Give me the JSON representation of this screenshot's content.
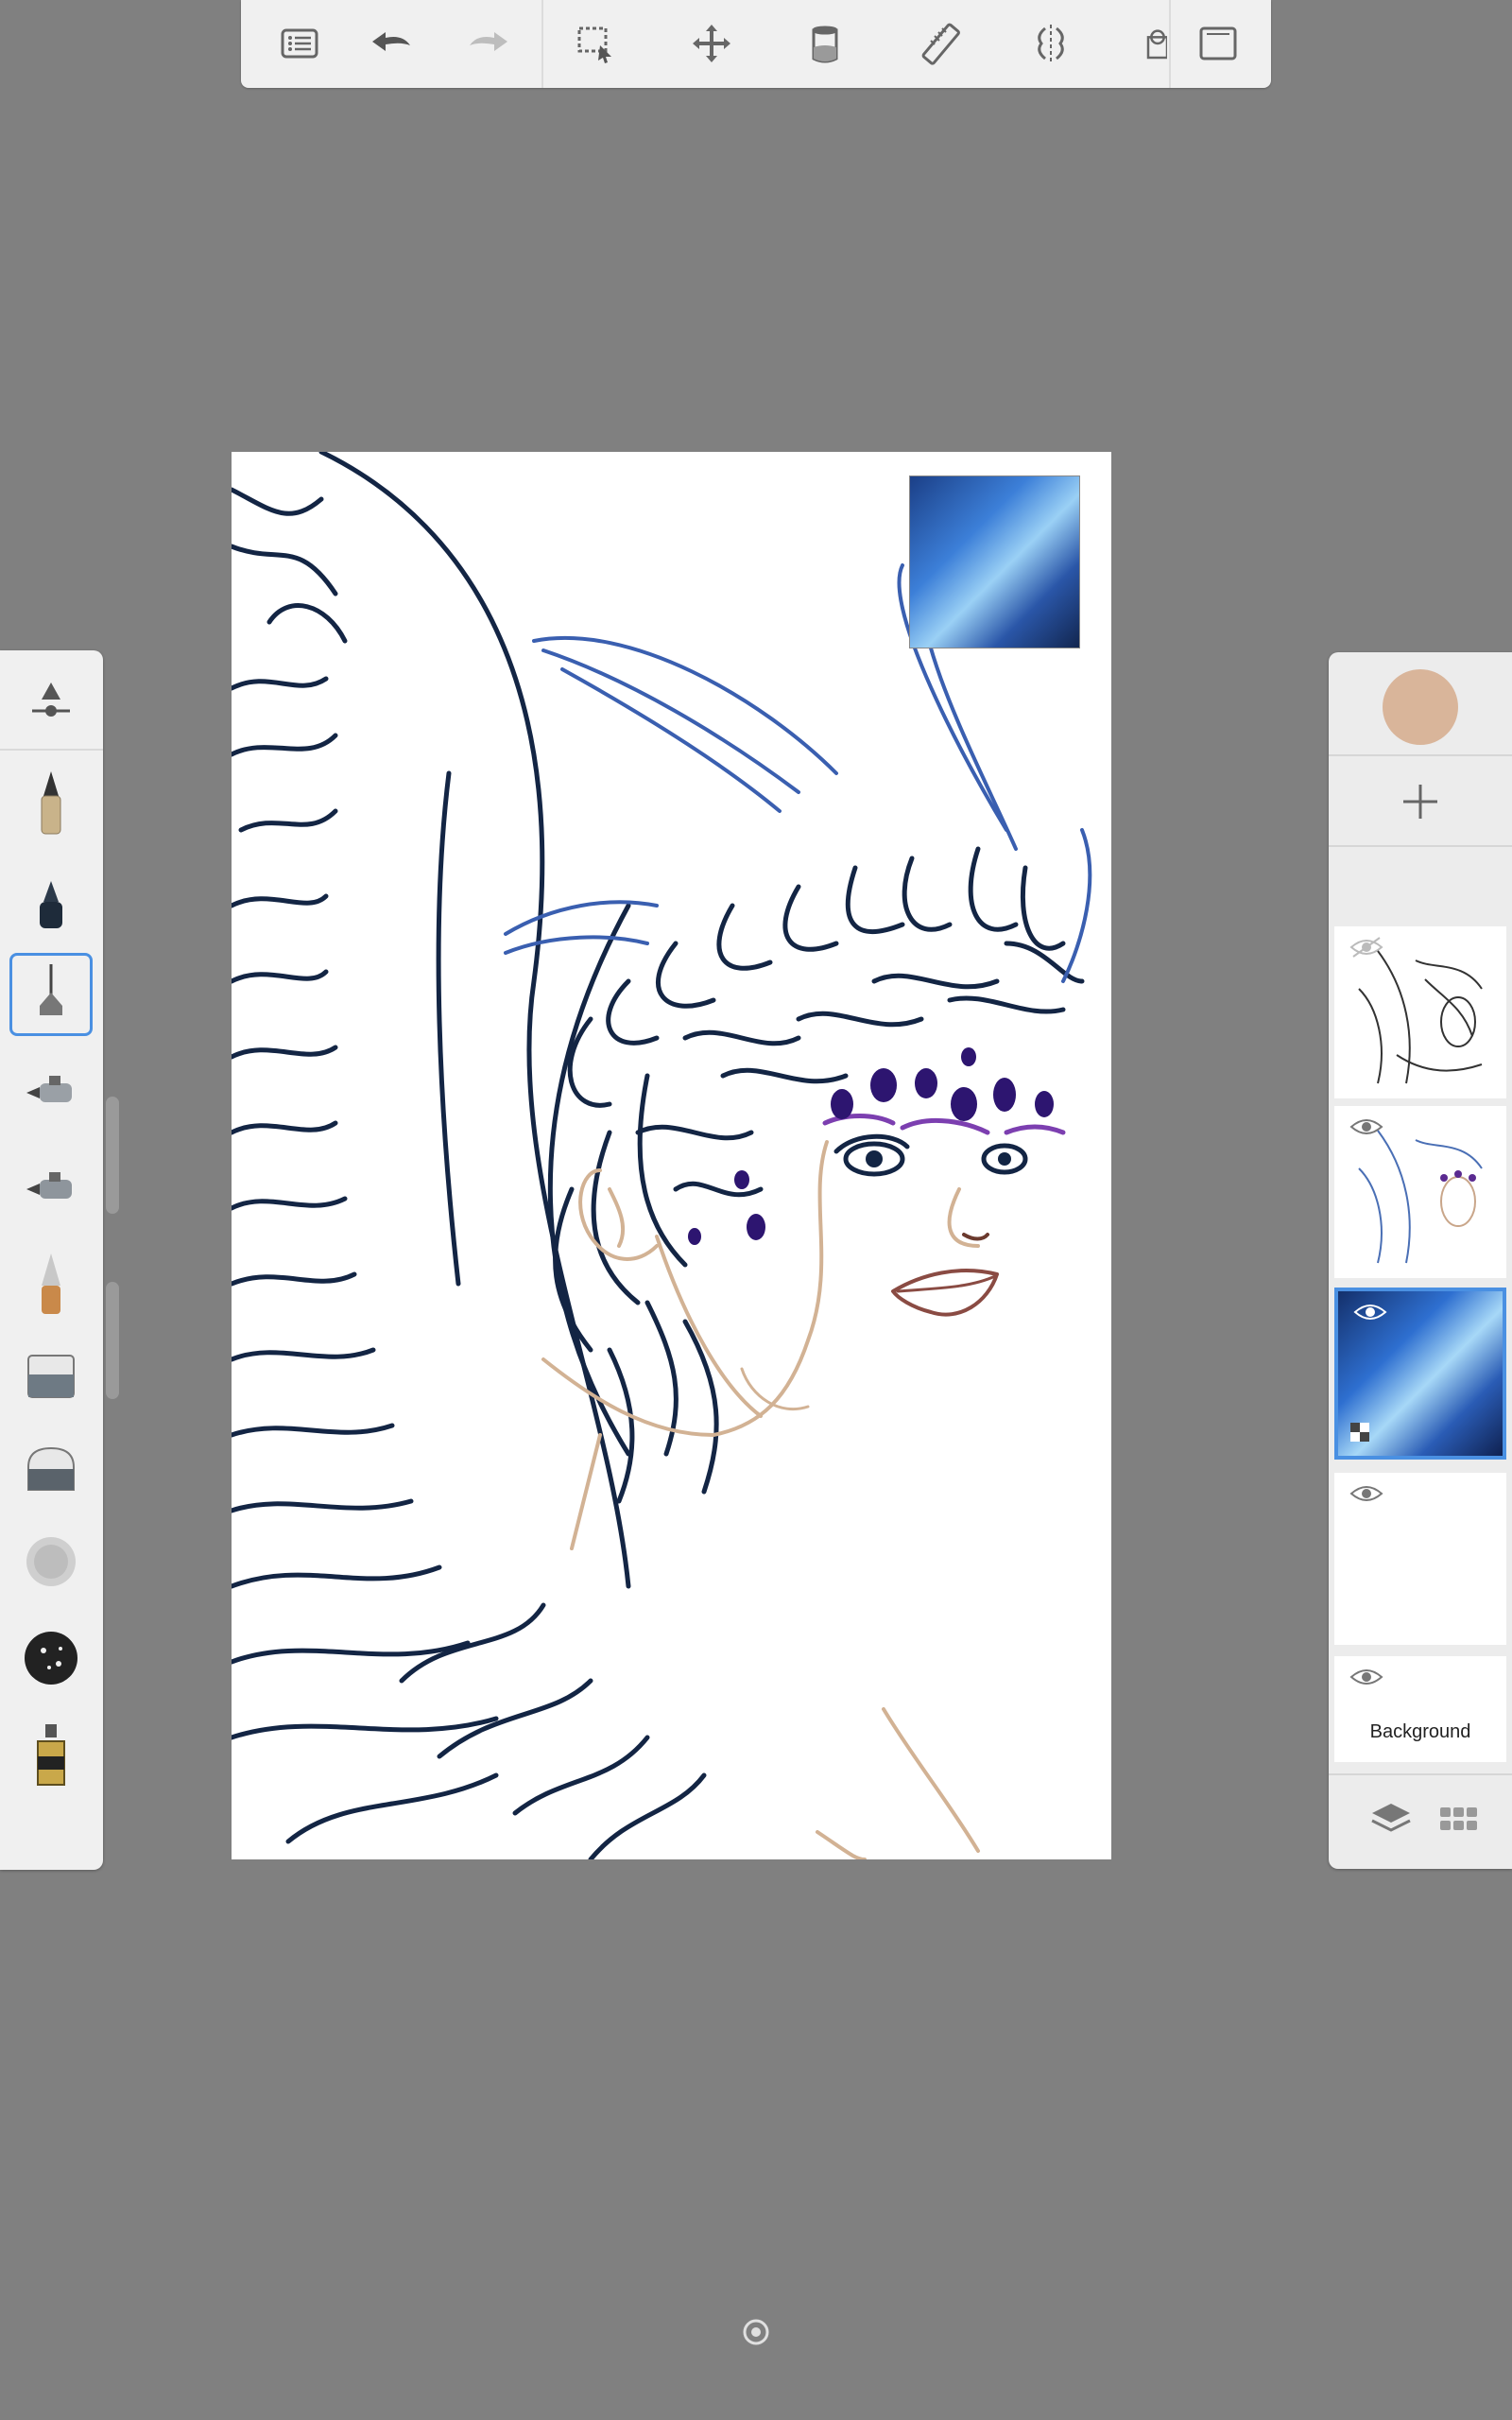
{
  "toolbar": {
    "items": [
      "menu-icon",
      "undo-icon",
      "redo-icon",
      "selection-icon",
      "transform-icon",
      "fill-icon",
      "ruler-icon",
      "symmetry-icon",
      "shape-icon",
      "fullscreen-icon"
    ]
  },
  "brushes": {
    "items": [
      "brush-properties",
      "pencil",
      "ballpoint-pen",
      "technical-pen",
      "airbrush",
      "airbrush-2",
      "marker",
      "chisel-eraser",
      "soft-eraser",
      "spray",
      "splatter",
      "paint-tube"
    ],
    "selected_index": 3
  },
  "layers": {
    "current_color": "#d9b59a",
    "items": [
      {
        "name": "",
        "visible": false
      },
      {
        "name": "",
        "visible": true
      },
      {
        "name": "",
        "visible": true,
        "selected": true
      },
      {
        "name": "",
        "visible": true
      },
      {
        "name": "Background",
        "visible": true
      }
    ]
  },
  "colors": {
    "line_dark": "#132544",
    "line_blue": "#3a5fb0",
    "line_purple": "#2d1570",
    "skin": "#d2b294",
    "lips": "#8a4b43",
    "accent": "#4a90e2"
  }
}
